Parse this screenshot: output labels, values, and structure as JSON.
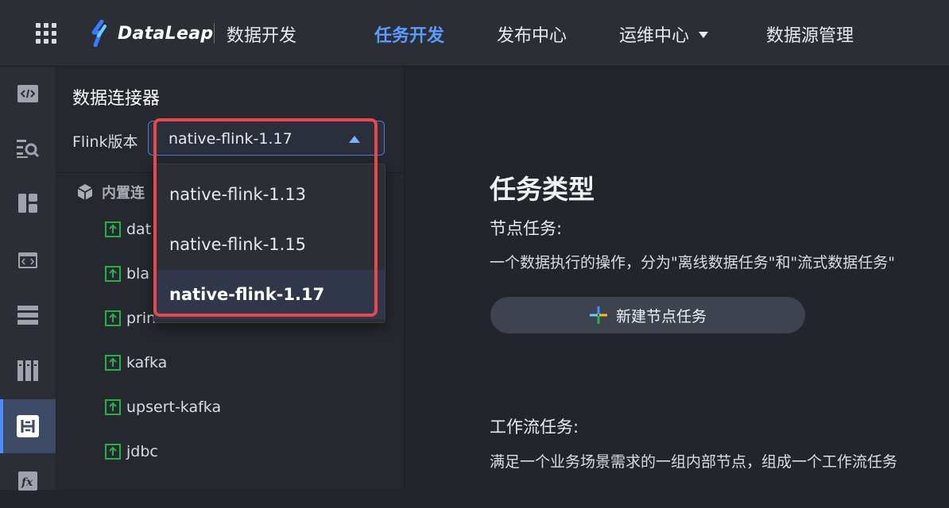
{
  "header": {
    "logo_text": "DataLeap",
    "product_name": "数据开发",
    "nav": [
      {
        "label": "任务开发",
        "active": true
      },
      {
        "label": "发布中心",
        "active": false
      },
      {
        "label": "运维中心",
        "active": false,
        "has_dropdown": true
      },
      {
        "label": "数据源管理",
        "active": false
      }
    ]
  },
  "rail": {
    "items": [
      {
        "icon": "code-icon"
      },
      {
        "icon": "search-list-icon"
      },
      {
        "icon": "dashboard-icon"
      },
      {
        "icon": "code-window-icon"
      },
      {
        "icon": "stack-icon"
      },
      {
        "icon": "columns-icon"
      },
      {
        "icon": "connector-icon",
        "active": true
      },
      {
        "icon": "function-icon"
      }
    ]
  },
  "panel": {
    "title": "数据连接器",
    "version_label": "Flink版本",
    "selected_version": "native-flink-1.17",
    "group_label": "内置连",
    "connectors": [
      "dat",
      "bla",
      "print",
      "kafka",
      "upsert-kafka",
      "jdbc"
    ]
  },
  "dropdown": {
    "options": [
      "native-flink-1.13",
      "native-flink-1.15",
      "native-flink-1.17"
    ],
    "selected": "native-flink-1.17"
  },
  "main": {
    "title": "任务类型",
    "node_task_title": "节点任务:",
    "node_task_desc": "一个数据执行的操作，分为\"离线数据任务\"和\"流式数据任务\"",
    "new_node_button": "新建节点任务",
    "workflow_title": "工作流任务:",
    "workflow_desc": "满足一个业务场景需求的一组内部节点，组成一个工作流任务"
  },
  "colors": {
    "accent": "#5b9bff",
    "highlight": "#e8474c",
    "connector_icon": "#27b04a"
  }
}
